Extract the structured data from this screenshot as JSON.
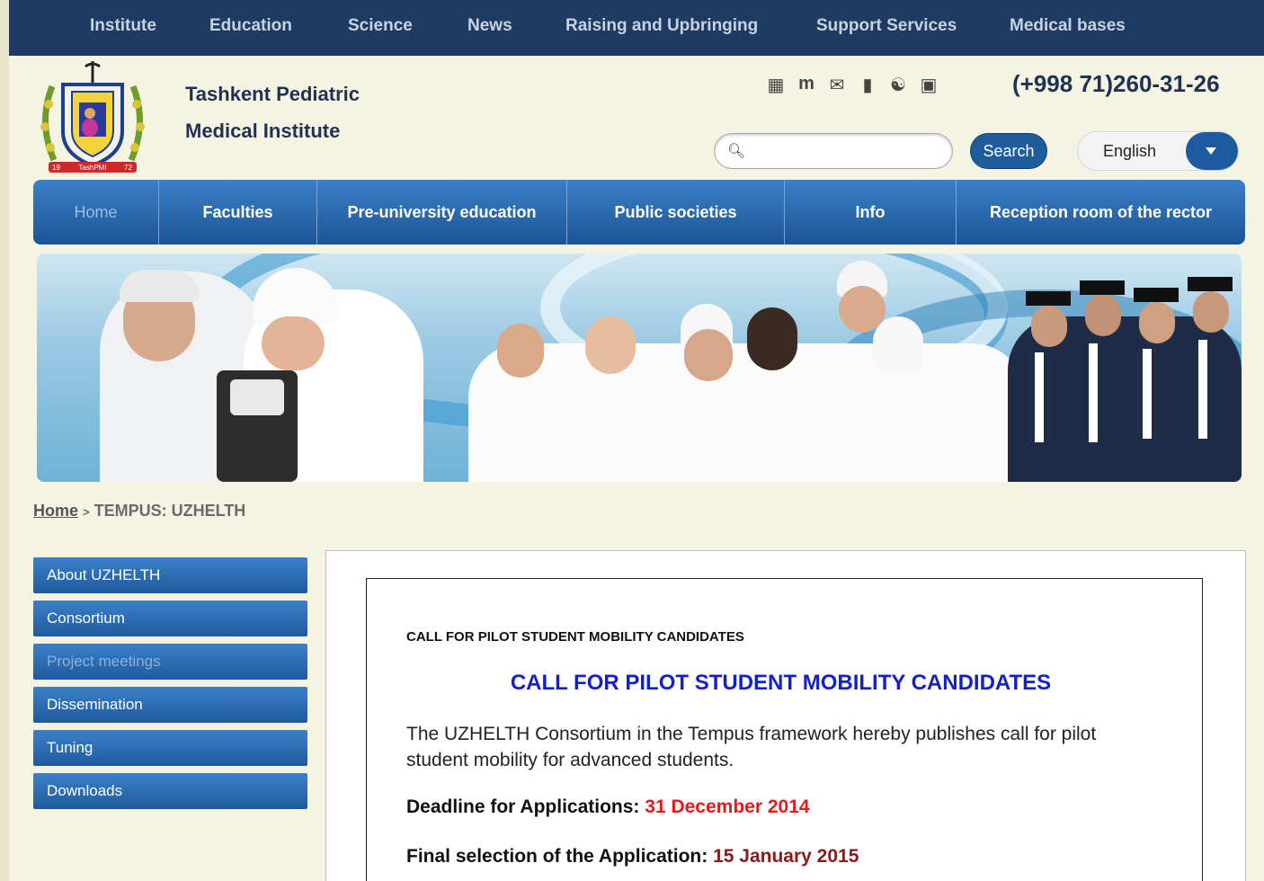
{
  "top_nav": [
    "Institute",
    "Education",
    "Science",
    "News",
    "Raising and Upbringing",
    "Support Services",
    "Medical bases"
  ],
  "header": {
    "name_line1": "Tashkent Pediatric",
    "name_line2": "Medical Institute",
    "logo_text": "TashPMI",
    "logo_year_left": "19",
    "logo_year_right": "72",
    "phone": "(+998 71)260-31-26",
    "icons": [
      "document-icon",
      "moodle-icon",
      "mail-icon",
      "phone-book-icon",
      "sitemap-icon",
      "library-icon"
    ]
  },
  "search": {
    "value": "",
    "button_label": "Search"
  },
  "language": {
    "selected": "English"
  },
  "main_nav": [
    "Home",
    "Faculties",
    "Pre-university education",
    "Public societies",
    "Info",
    "Reception room of the rector"
  ],
  "breadcrumb": {
    "home": "Home",
    "separator": ">",
    "current": "TEMPUS: UZHELTH"
  },
  "side_menu": [
    "About UZHELTH",
    "Consortium",
    "Project meetings",
    "Dissemination",
    "Tuning",
    "Downloads"
  ],
  "content": {
    "small_title": "CALL FOR PILOT STUDENT MOBILITY CANDIDATES",
    "big_title": "CALL FOR PILOT STUDENT MOBILITY CANDIDATES",
    "paragraph": "The UZHELTH Consortium in the Tempus framework hereby publishes call for pilot student mobility for advanced students.",
    "deadline_label": "Deadline for Applications:",
    "deadline_value": "31 December 2014",
    "selection_label": "Final selection of the Application:",
    "selection_value": "15 January 2015"
  },
  "colors": {
    "topnav_bg": "#1f3a63",
    "accent_blue": "#1f5a9e",
    "title_blue": "#1421c9",
    "deadline_red": "#e31b1b"
  }
}
